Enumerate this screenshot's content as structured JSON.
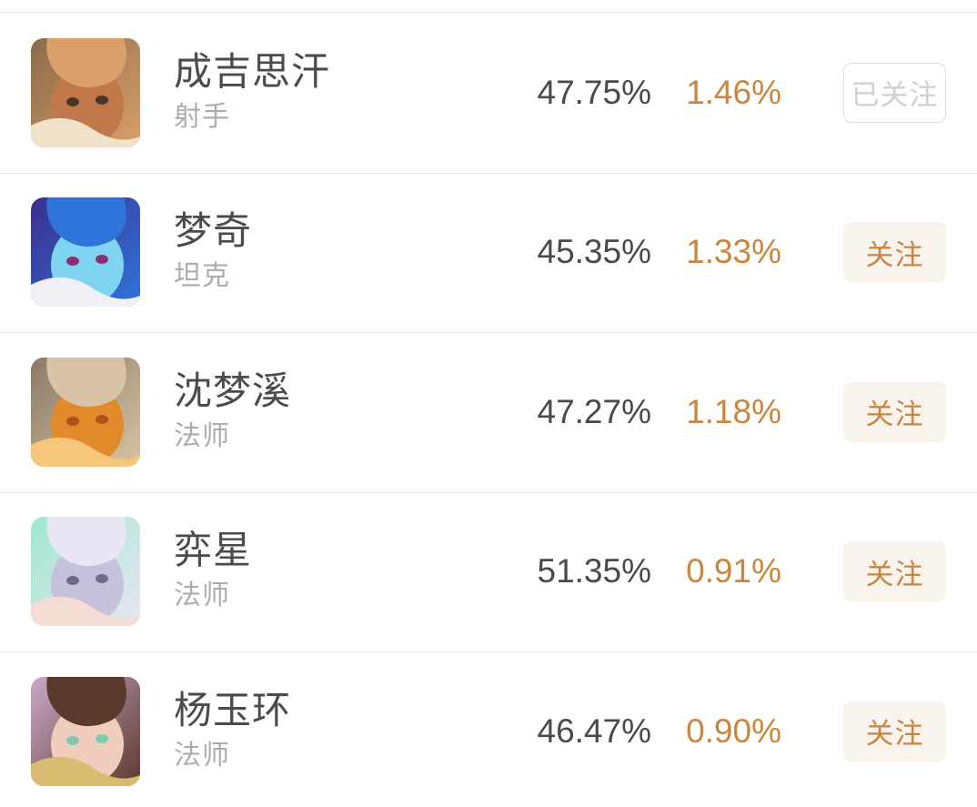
{
  "list": {
    "rows": [
      {
        "name": "成吉思汗",
        "role": "射手",
        "win_rate": "47.75%",
        "delta": "1.46%",
        "follow_label": "已关注",
        "followed": true,
        "avatar_name": "avatar-chengjisihan",
        "avatar_colors": [
          "#8b6b4a",
          "#d9a06a",
          "#c0784a",
          "#f0e2c8",
          "#4a3526"
        ]
      },
      {
        "name": "梦奇",
        "role": "坦克",
        "win_rate": "45.35%",
        "delta": "1.33%",
        "follow_label": "关注",
        "followed": false,
        "avatar_name": "avatar-mengqi",
        "avatar_colors": [
          "#3b2f8f",
          "#2f74d8",
          "#7fd4f2",
          "#f2f0f7",
          "#8e2f74"
        ]
      },
      {
        "name": "沈梦溪",
        "role": "法师",
        "win_rate": "47.27%",
        "delta": "1.18%",
        "follow_label": "关注",
        "followed": false,
        "avatar_name": "avatar-shenmengxi",
        "avatar_colors": [
          "#8a7a66",
          "#d8c4a4",
          "#e08a2a",
          "#f6c77a",
          "#b44f1c"
        ]
      },
      {
        "name": "弈星",
        "role": "法师",
        "win_rate": "51.35%",
        "delta": "0.91%",
        "follow_label": "关注",
        "followed": false,
        "avatar_name": "avatar-yixing",
        "avatar_colors": [
          "#9fe8cd",
          "#e8e6f2",
          "#c6c2dc",
          "#f3ddd4",
          "#6f6a8c"
        ]
      },
      {
        "name": "杨玉环",
        "role": "法师",
        "win_rate": "46.47%",
        "delta": "0.90%",
        "follow_label": "关注",
        "followed": false,
        "avatar_name": "avatar-yangyuhuan",
        "avatar_colors": [
          "#c9a8c8",
          "#5b3a2e",
          "#f0cdbc",
          "#d9bb72",
          "#7ec9b4"
        ]
      }
    ]
  },
  "colors": {
    "accent": "#c8863f",
    "follow_bg": "#f8f3ed",
    "text_primary": "#4a4a4a",
    "text_secondary": "#adadad",
    "divider": "#e8e8e8",
    "followed_border": "#dcdcdc",
    "followed_text": "#d0d0d0"
  }
}
